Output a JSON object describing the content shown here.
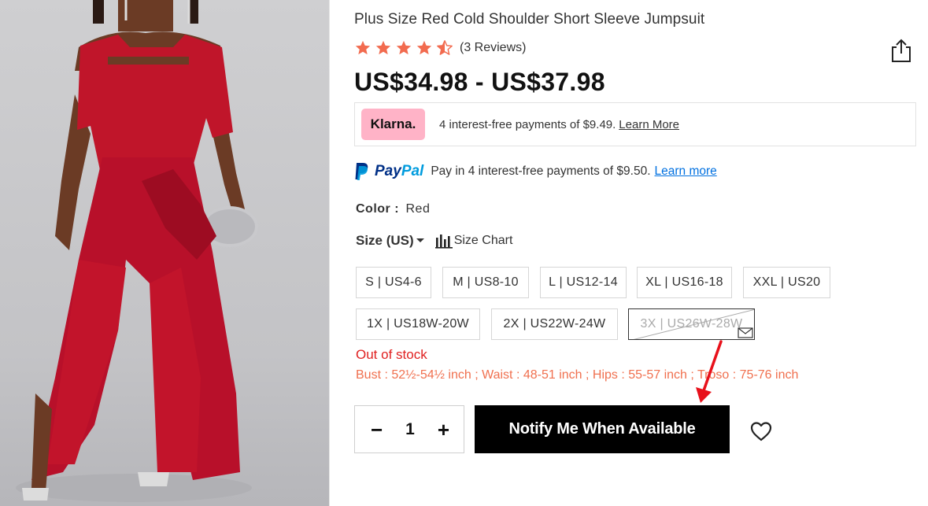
{
  "product": {
    "title": "Plus Size Red Cold Shoulder Short Sleeve Jumpsuit",
    "rating_stars": 4.5,
    "reviews_text": "(3 Reviews)",
    "price_range": "US$34.98 - US$37.98"
  },
  "klarna": {
    "logo": "Klarna.",
    "text": "4 interest-free payments of $9.49.",
    "link": "Learn More"
  },
  "paypal": {
    "brand_pay": "Pay",
    "brand_pal": "Pal",
    "text": "Pay in 4 interest-free payments of $9.50.",
    "link": "Learn more"
  },
  "color": {
    "label": "Color :",
    "value": "Red"
  },
  "size": {
    "label": "Size (US)",
    "chart_label": "Size Chart",
    "options": [
      {
        "label": "S | US4-6",
        "available": true
      },
      {
        "label": "M | US8-10",
        "available": true
      },
      {
        "label": "L | US12-14",
        "available": true
      },
      {
        "label": "XL | US16-18",
        "available": true
      },
      {
        "label": "XXL | US20",
        "available": true
      },
      {
        "label": "1X | US18W-20W",
        "available": true
      },
      {
        "label": "2X | US22W-24W",
        "available": true
      },
      {
        "label": "3X | US26W-28W",
        "available": false,
        "selected": true
      }
    ]
  },
  "stock_status": "Out of stock",
  "measurements": "Bust : 52½-54½ inch ; Waist : 48-51 inch ; Hips : 55-57 inch ; Troso : 75-76 inch",
  "quantity": {
    "minus": "−",
    "value": "1",
    "plus": "+"
  },
  "notify_button": "Notify Me When Available",
  "icons": [
    "star-icon",
    "share-icon",
    "size-chart-icon",
    "mail-icon",
    "heart-icon",
    "paypal-logo"
  ],
  "colors": {
    "star": "#f26b4f",
    "klarna_pink": "#ffb3c7",
    "paypal_blue": "#003087",
    "paypal_light": "#009cde",
    "out_of_stock": "#e02020",
    "measurements": "#f0704f",
    "annotation_arrow": "#e8111b"
  }
}
